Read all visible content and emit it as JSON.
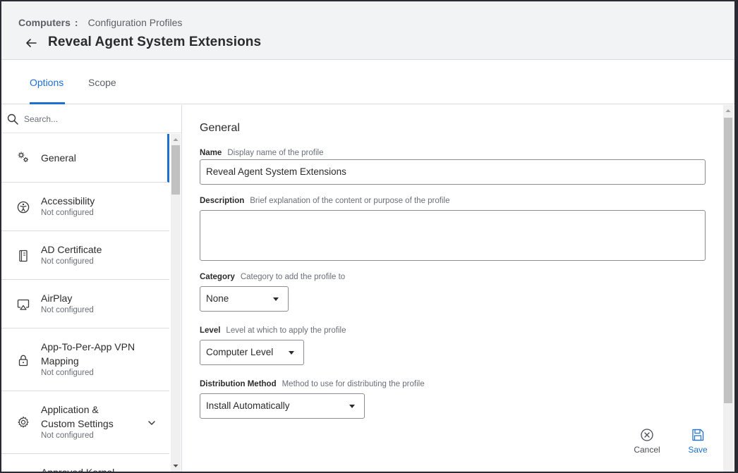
{
  "breadcrumb": {
    "root": "Computers",
    "separator": ":",
    "current": "Configuration Profiles"
  },
  "page": {
    "title": "Reveal Agent System Extensions"
  },
  "tabs": [
    {
      "label": "Options"
    },
    {
      "label": "Scope"
    }
  ],
  "search": {
    "placeholder": "Search..."
  },
  "sidebar": {
    "items": [
      {
        "label": "General",
        "status": "",
        "icon": "gear-cluster-icon"
      },
      {
        "label": "Accessibility",
        "status": "Not configured",
        "icon": "accessibility-icon"
      },
      {
        "label": "AD Certificate",
        "status": "Not configured",
        "icon": "certificate-icon"
      },
      {
        "label": "AirPlay",
        "status": "Not configured",
        "icon": "airplay-icon"
      },
      {
        "label": "App-To-Per-App VPN Mapping",
        "label_line1": "App-To-Per-App VPN",
        "label_line2": "Mapping",
        "status": "Not configured",
        "icon": "lock-icon"
      },
      {
        "label": "Application & Custom Settings",
        "label_line1": "Application &",
        "label_line2": "Custom Settings",
        "status": "Not configured",
        "icon": "gear-icon"
      },
      {
        "label": "Approved Kernel",
        "status": "",
        "icon": ""
      }
    ]
  },
  "form": {
    "section_title": "General",
    "name": {
      "label": "Name",
      "help": "Display name of the profile",
      "value": "Reveal Agent System Extensions"
    },
    "description": {
      "label": "Description",
      "help": "Brief explanation of the content or purpose of the profile",
      "value": ""
    },
    "category": {
      "label": "Category",
      "help": "Category to add the profile to",
      "value": "None"
    },
    "level": {
      "label": "Level",
      "help": "Level at which to apply the profile",
      "value": "Computer Level"
    },
    "distribution": {
      "label": "Distribution Method",
      "help": "Method to use for distributing the profile",
      "value": "Install Automatically"
    }
  },
  "actions": {
    "cancel": "Cancel",
    "save": "Save"
  },
  "colors": {
    "accent": "#1f6fcf",
    "header_bg": "#f2f3f5",
    "border": "#d9dbe0"
  }
}
